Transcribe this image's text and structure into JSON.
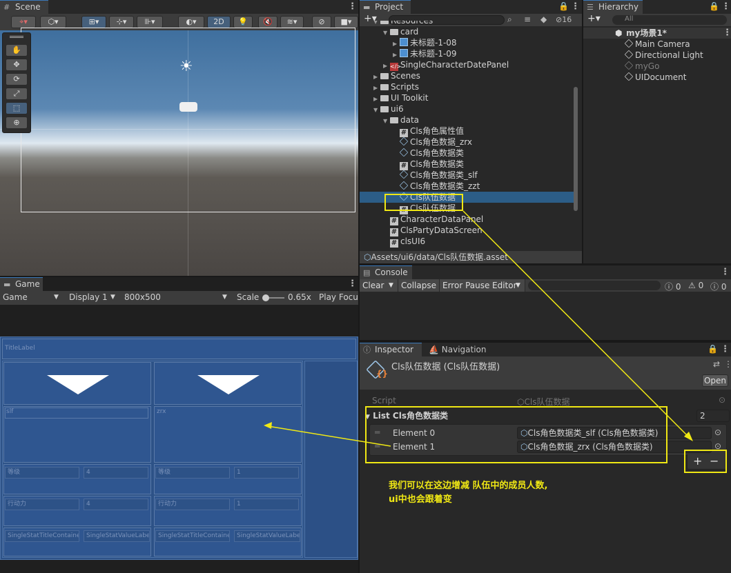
{
  "scene": {
    "tab": "Scene",
    "btn_2d": "2D"
  },
  "game": {
    "tab": "Game",
    "display_dropdown": "Game",
    "display_num": "Display 1",
    "resolution": "800x500",
    "scale_label": "Scale",
    "scale_value": "0.65x",
    "play_focus": "Play Focu",
    "title_label": "TitleLabel",
    "cards": [
      {
        "name": "slf",
        "level_label": "等级",
        "level": "4",
        "action_label": "行动力",
        "action": "4",
        "title_container": "SingleStatTitleContainer",
        "value_label": "SingleStatValueLabel"
      },
      {
        "name": "zrx",
        "level_label": "等级",
        "level": "1",
        "action_label": "行动力",
        "action": "1",
        "title_container": "SingleStatTitleContainer",
        "value_label": "SingleStatValueLabel"
      }
    ]
  },
  "project": {
    "tab": "Project",
    "badge_count": "16",
    "path": "Assets/ui6/data/Cls队伍数据.asset",
    "items": [
      {
        "label": "Resources",
        "type": "folder",
        "depth": 1,
        "open": true
      },
      {
        "label": "card",
        "type": "folder",
        "depth": 2,
        "open": true
      },
      {
        "label": "未标题-1-08",
        "type": "image",
        "depth": 3
      },
      {
        "label": "未标题-1-09",
        "type": "image",
        "depth": 3
      },
      {
        "label": "SingleCharacterDatePanel",
        "type": "prefab",
        "depth": 2
      },
      {
        "label": "Scenes",
        "type": "folder",
        "depth": 1
      },
      {
        "label": "Scripts",
        "type": "folder",
        "depth": 1
      },
      {
        "label": "UI Toolkit",
        "type": "folder",
        "depth": 1
      },
      {
        "label": "ui6",
        "type": "folder",
        "depth": 1,
        "open": true
      },
      {
        "label": "data",
        "type": "folder",
        "depth": 2,
        "open": true
      },
      {
        "label": "Cls角色属性值",
        "type": "script",
        "depth": 3
      },
      {
        "label": "Cls角色数据_zrx",
        "type": "asset",
        "depth": 3
      },
      {
        "label": "Cls角色数据类",
        "type": "asset",
        "depth": 3
      },
      {
        "label": "Cls角色数据类",
        "type": "script",
        "depth": 3
      },
      {
        "label": "Cls角色数据类_slf",
        "type": "asset",
        "depth": 3
      },
      {
        "label": "Cls角色数据类_zzt",
        "type": "asset",
        "depth": 3
      },
      {
        "label": "Cls队伍数据",
        "type": "asset",
        "depth": 3,
        "selected": true
      },
      {
        "label": "Cls队伍数据",
        "type": "script",
        "depth": 3
      },
      {
        "label": "CharacterDataPanel",
        "type": "script",
        "depth": 2
      },
      {
        "label": "ClsPartyDataScreen",
        "type": "script",
        "depth": 2
      },
      {
        "label": "clsUI6",
        "type": "script",
        "depth": 2
      }
    ]
  },
  "hierarchy": {
    "tab": "Hierarchy",
    "search_placeholder": "All",
    "scene_name": "my场景1*",
    "items": [
      "Main Camera",
      "Directional Light",
      "myGo",
      "UIDocument"
    ]
  },
  "console": {
    "tab": "Console",
    "clear": "Clear",
    "collapse": "Collapse",
    "error_pause": "Error Pause",
    "editor": "Editor",
    "count_log": "0",
    "count_warn": "0",
    "count_err": "0"
  },
  "inspector": {
    "tab": "Inspector",
    "tab2": "Navigation",
    "asset_title": "Cls队伍数据 (Cls队伍数据)",
    "open_btn": "Open",
    "script_label": "Script",
    "script_value": "Cls队伍数据",
    "list_label": "List Cls角色数据类",
    "list_count": "2",
    "elements": [
      {
        "label": "Element 0",
        "value": "Cls角色数据类_slf (Cls角色数据类)"
      },
      {
        "label": "Element 1",
        "value": "Cls角色数据_zrx (Cls角色数据类)"
      }
    ],
    "add_btn": "+",
    "remove_btn": "−"
  },
  "annotation": {
    "line1": "我们可以在这边增减 队伍中的成员人数,",
    "line2": "ui中也会跟着变"
  },
  "colors": {
    "annotation": "#f0e814",
    "accent": "#3a79bb",
    "selected_row": "#2c5d87",
    "ui_panel": "#2f5690"
  }
}
